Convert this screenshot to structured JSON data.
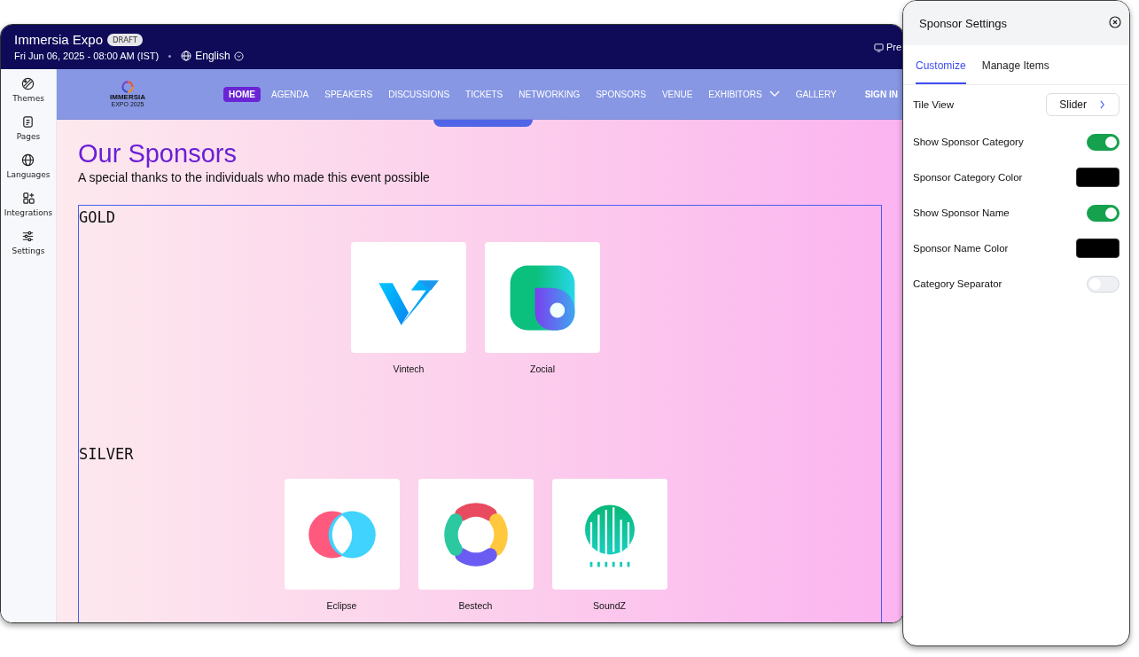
{
  "window": {
    "title": "Immersia Expo",
    "badge": "DRAFT",
    "date": "Fri Jun 06, 2025 - 08:00 AM (IST)",
    "language": "English",
    "preview_partial": "Pre"
  },
  "sidebar": {
    "items": [
      {
        "label": "Themes"
      },
      {
        "label": "Pages"
      },
      {
        "label": "Languages"
      },
      {
        "label": "Integrations"
      },
      {
        "label": "Settings"
      }
    ]
  },
  "site_nav": {
    "logo_text": "IMMERSIA",
    "logo_sub": "EXPO 2025",
    "items": [
      {
        "label": "HOME",
        "selected": true,
        "dropdown": false
      },
      {
        "label": "AGENDA",
        "selected": false,
        "dropdown": false
      },
      {
        "label": "SPEAKERS",
        "selected": false,
        "dropdown": false
      },
      {
        "label": "DISCUSSIONS",
        "selected": false,
        "dropdown": false
      },
      {
        "label": "TICKETS",
        "selected": false,
        "dropdown": false
      },
      {
        "label": "NETWORKING",
        "selected": false,
        "dropdown": false
      },
      {
        "label": "SPONSORS",
        "selected": false,
        "dropdown": false
      },
      {
        "label": "VENUE",
        "selected": false,
        "dropdown": false
      },
      {
        "label": "EXHIBITORS",
        "selected": false,
        "dropdown": true
      },
      {
        "label": "GALLERY",
        "selected": false,
        "dropdown": false
      }
    ],
    "sign_in": "SIGN IN"
  },
  "section": {
    "title": "Our Sponsors",
    "subtitle": "A special thanks to the individuals who made this event possible",
    "categories": [
      {
        "name": "GOLD",
        "sponsors": [
          {
            "name": "Vintech"
          },
          {
            "name": "Zocial"
          }
        ]
      },
      {
        "name": "SILVER",
        "sponsors": [
          {
            "name": "Eclipse"
          },
          {
            "name": "Bestech"
          },
          {
            "name": "SoundZ"
          }
        ]
      }
    ]
  },
  "settings_panel": {
    "title": "Sponsor Settings",
    "tabs": [
      {
        "label": "Customize",
        "selected": true
      },
      {
        "label": "Manage Items",
        "selected": false
      }
    ],
    "rows": [
      {
        "kind": "select",
        "label": "Tile View",
        "value": "Slider"
      },
      {
        "kind": "toggle",
        "label": "Show Sponsor Category",
        "on": true
      },
      {
        "kind": "color",
        "label": "Sponsor Category Color",
        "color": "#000000"
      },
      {
        "kind": "toggle",
        "label": "Show Sponsor Name",
        "on": true
      },
      {
        "kind": "color",
        "label": "Sponsor Name Color",
        "color": "#000000"
      },
      {
        "kind": "toggle",
        "label": "Category Separator",
        "on": false
      }
    ]
  }
}
